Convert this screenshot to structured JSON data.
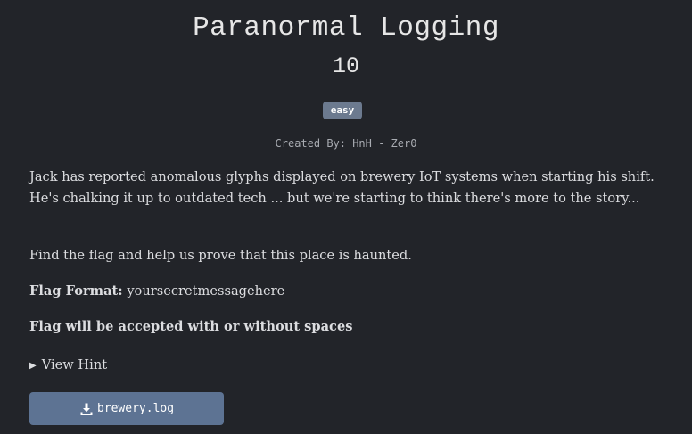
{
  "challenge": {
    "title": "Paranormal Logging",
    "points": "10",
    "difficulty": "easy",
    "author": "Created By: HnH - Zer0",
    "description": [
      "Jack has reported anomalous glyphs displayed on brewery IoT systems when starting his shift. He's chalking it up to outdated tech ... but we're starting to think there's more to the story...",
      "Find the flag and help us prove that this place is haunted."
    ],
    "flag_format_label": "Flag Format:",
    "flag_format_value": "yoursecretmessagehere",
    "flag_note": "Flag will be accepted with or without spaces",
    "hint_label": "View Hint",
    "file": {
      "name": "brewery.log",
      "icon": "download-icon"
    }
  },
  "colors": {
    "background": "#222429",
    "badge": "#6c7a8f",
    "button": "#5d7393",
    "text": "#dcdde0"
  }
}
